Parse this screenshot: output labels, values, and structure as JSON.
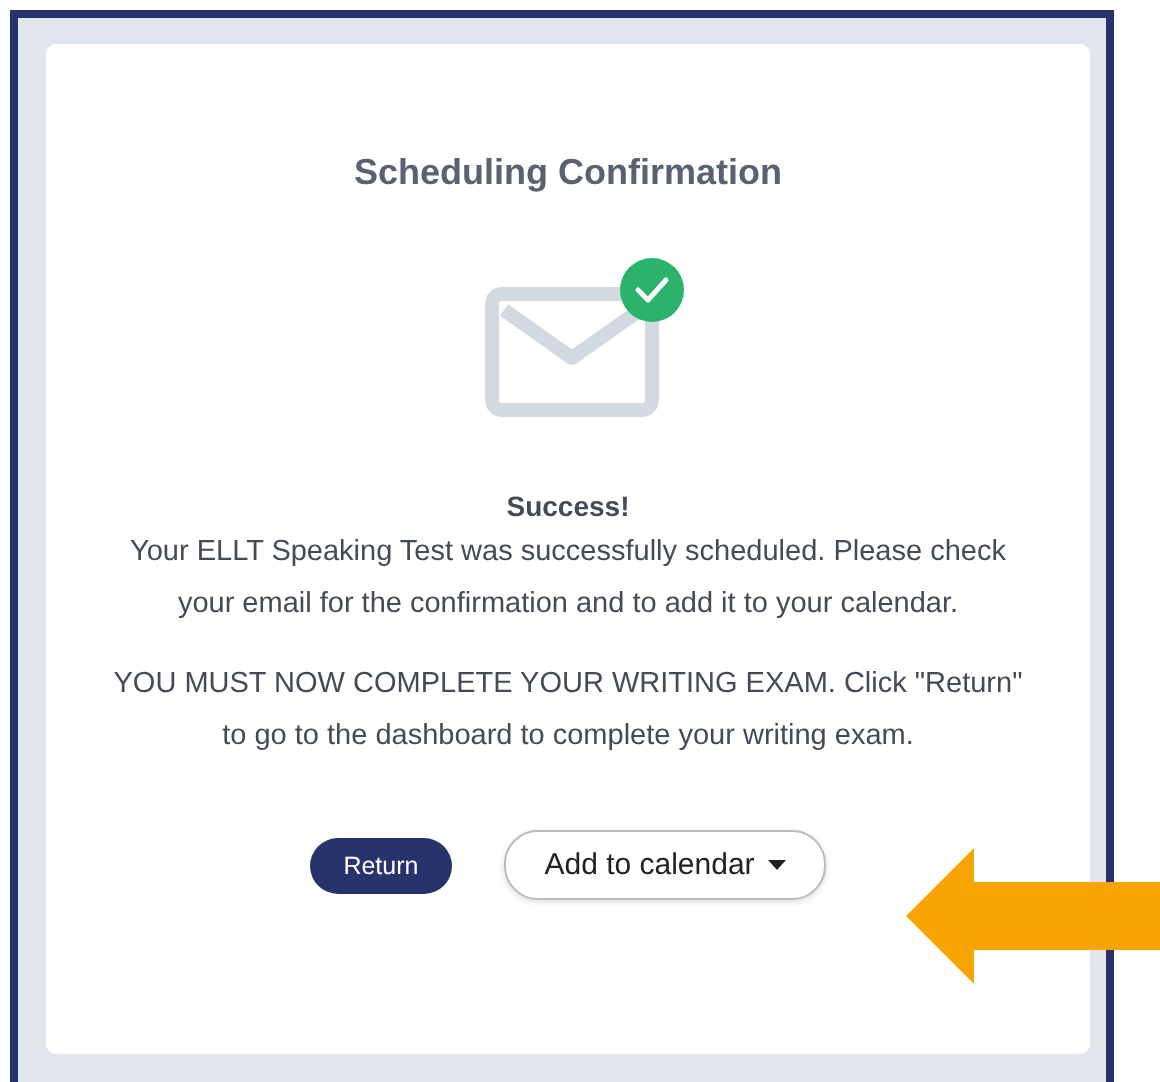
{
  "card": {
    "title": "Scheduling Confirmation",
    "message": {
      "heading": "Success!",
      "text": "Your ELLT Speaking Test was successfully scheduled. Please check your email for the confirmation and to add it to your calendar."
    },
    "instruction": "YOU MUST NOW COMPLETE YOUR WRITING EXAM. Click \"Return\" to go to the dashboard to complete your writing exam.",
    "buttons": [
      {
        "kind": "primary",
        "label": "Return"
      },
      {
        "kind": "dropdown",
        "label": "Add to calendar"
      }
    ]
  }
}
